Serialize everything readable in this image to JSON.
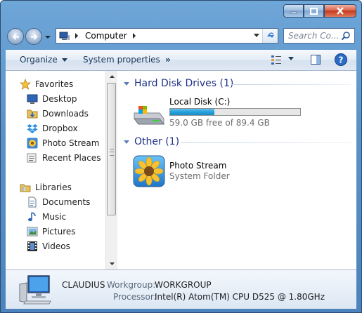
{
  "window": {
    "caption_buttons": [
      {
        "name": "minimize",
        "icon": "minimize-icon"
      },
      {
        "name": "maximize",
        "icon": "maximize-icon"
      },
      {
        "name": "close",
        "icon": "close-icon"
      }
    ]
  },
  "address_bar": {
    "location": "Computer"
  },
  "search": {
    "placeholder": "Search Co..."
  },
  "toolbar": {
    "organize": "Organize",
    "system_properties": "System properties",
    "more": "»"
  },
  "nav": {
    "favorites_header": "Favorites",
    "favorites": [
      {
        "label": "Desktop",
        "icon": "desktop-icon"
      },
      {
        "label": "Downloads",
        "icon": "downloads-icon"
      },
      {
        "label": "Dropbox",
        "icon": "dropbox-icon"
      },
      {
        "label": "Photo Stream",
        "icon": "photo-stream-icon"
      },
      {
        "label": "Recent Places",
        "icon": "recent-places-icon"
      }
    ],
    "libraries_header": "Libraries",
    "libraries": [
      {
        "label": "Documents",
        "icon": "documents-icon"
      },
      {
        "label": "Music",
        "icon": "music-icon"
      },
      {
        "label": "Pictures",
        "icon": "pictures-icon"
      },
      {
        "label": "Videos",
        "icon": "videos-icon"
      }
    ]
  },
  "content": {
    "group1_header": "Hard Disk Drives (1)",
    "drive": {
      "name": "Local Disk (C:)",
      "free_text": "59.0 GB free of 89.4 GB",
      "used_fraction": 0.34
    },
    "group2_header": "Other (1)",
    "other_item": {
      "name": "Photo Stream",
      "type": "System Folder"
    }
  },
  "details": {
    "computer_name": "CLAUDIUS",
    "workgroup_label": "Workgroup:",
    "workgroup_value": "WORKGROUP",
    "processor_label": "Processor:",
    "processor_value": "Intel(R) Atom(TM) CPU D525  @ 1.80GHz"
  },
  "colors": {
    "group_header": "#1e3287",
    "drive_bar_fill": "#26a0da",
    "toolbar_text": "#1e395b"
  }
}
